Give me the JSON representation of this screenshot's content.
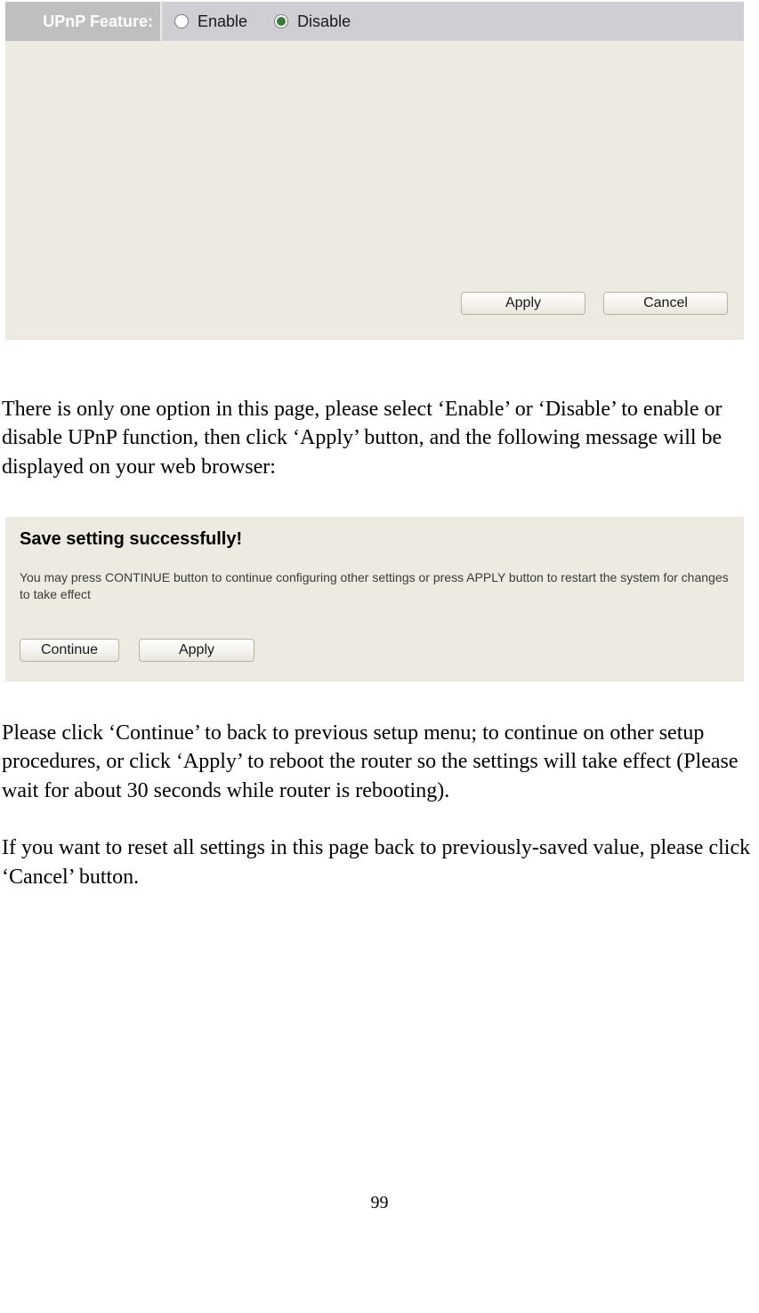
{
  "panel1": {
    "label": "UPnP Feature:",
    "option_enable": "Enable",
    "option_disable": "Disable",
    "selected": "disable",
    "apply_label": "Apply",
    "cancel_label": "Cancel"
  },
  "para1": "There is only one option in this page, please select ‘Enable’ or ‘Disable’ to enable or disable UPnP function, then click ‘Apply’ button, and the following message will be displayed on your web browser:",
  "panel2": {
    "title": "Save setting successfully!",
    "body": "You may press CONTINUE button to continue configuring other settings or press APPLY button to restart the system for changes to take effect",
    "continue_label": "Continue",
    "apply_label": "Apply"
  },
  "para2": "Please click ‘Continue’ to back to previous setup menu; to continue on other setup procedures, or click ‘Apply’ to reboot the router so the settings will take effect (Please wait for about 30 seconds while router is rebooting).",
  "para3": "If you want to reset all settings in this page back to previously-saved value, please click ‘Cancel’ button.",
  "page_number": "99"
}
